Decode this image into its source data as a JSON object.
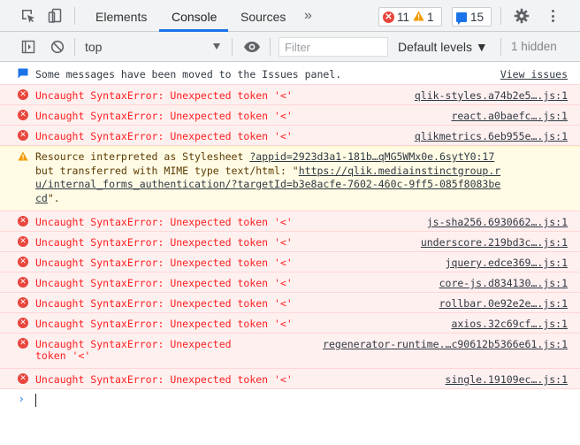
{
  "tabs": [
    {
      "label": "Elements"
    },
    {
      "label": "Console"
    },
    {
      "label": "Sources"
    }
  ],
  "more_tabs_glyph": "»",
  "counts": {
    "errors": "11",
    "warnings": "1",
    "messages": "15"
  },
  "toolbar": {
    "context": "top",
    "filter_placeholder": "Filter",
    "levels": "Default levels ▼",
    "hidden": "1 hidden"
  },
  "info": {
    "text": "Some messages have been moved to the Issues panel.",
    "link": "View issues"
  },
  "errors_top": [
    {
      "text": "Uncaught SyntaxError: Unexpected token '<'",
      "source": "qlik-styles.a74b2e5….js:1"
    },
    {
      "text": "Uncaught SyntaxError: Unexpected token '<'",
      "source": "react.a0baefc….js:1"
    },
    {
      "text": "Uncaught SyntaxError: Unexpected token '<'",
      "source": "qlikmetrics.6eb955e….js:1"
    }
  ],
  "warning": {
    "line1": "Resource interpreted as Stylesheet ",
    "source": "?appid=2923d3a1-181b…qMG5WMx0e.6sytY0:17",
    "line2_prefix": "but transferred with MIME type text/html: \"",
    "line2_link": "https://qlik.mediainstinctgroup.r",
    "line3_link": "u/internal_forms_authentication/?targetId=b3e8acfe-7602-460c-9ff5-085f8083be",
    "line4_link": "cd",
    "line4_suffix": "\"."
  },
  "errors_bottom": [
    {
      "text": "Uncaught SyntaxError: Unexpected token '<'",
      "source": "js-sha256.6930662….js:1"
    },
    {
      "text": "Uncaught SyntaxError: Unexpected token '<'",
      "source": "underscore.219bd3c….js:1"
    },
    {
      "text": "Uncaught SyntaxError: Unexpected token '<'",
      "source": "jquery.edce369….js:1"
    },
    {
      "text": "Uncaught SyntaxError: Unexpected token '<'",
      "source": "core-js.d834130….js:1"
    },
    {
      "text": "Uncaught SyntaxError: Unexpected token '<'",
      "source": "rollbar.0e92e2e….js:1"
    },
    {
      "text": "Uncaught SyntaxError: Unexpected token '<'",
      "source": "axios.32c69cf….js:1"
    }
  ],
  "error_regen": {
    "line1": "Uncaught SyntaxError: Unexpected",
    "line2": "token '<'",
    "source": "regenerator-runtime.…c90612b5366e61.js:1"
  },
  "error_last": {
    "text": "Uncaught SyntaxError: Unexpected token '<'",
    "source": "single.19109ec….js:1"
  },
  "prompt_glyph": "›",
  "colors": {
    "accent": "#1a73e8",
    "error": "#e8453c",
    "warning": "#f29900"
  }
}
